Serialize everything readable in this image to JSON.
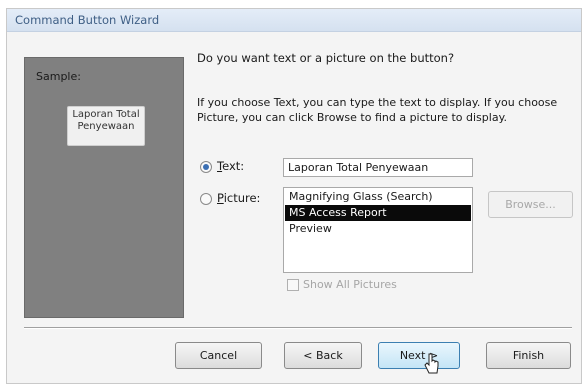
{
  "window": {
    "title": "Command Button Wizard"
  },
  "sample": {
    "label": "Sample:",
    "button_text": "Laporan Total Penyewaan"
  },
  "question": "Do you want text or a picture on the button?",
  "explanation": "If you choose Text, you can type the text to display.  If you choose Picture, you can click Browse to find a picture to display.",
  "options": {
    "text": {
      "label": "Text:",
      "accesskey": "T",
      "checked": true,
      "value": "Laporan Total Penyewaan"
    },
    "picture": {
      "label": "Picture:",
      "accesskey": "P",
      "checked": false
    }
  },
  "picture_list": {
    "items": [
      "Magnifying Glass (Search)",
      "MS Access Report",
      "Preview"
    ],
    "selected_index": 1
  },
  "browse_button": {
    "label": "Browse..."
  },
  "show_all_pictures": {
    "label": "Show All Pictures",
    "checked": false,
    "enabled": false
  },
  "buttons": {
    "cancel": "Cancel",
    "back": "< Back",
    "next": "Next >",
    "finish": "Finish"
  },
  "colors": {
    "sample_panel": "#808080",
    "selection": "#0a0a0a",
    "focus_border": "#3c7fb1",
    "title_text": "#3f5f85"
  }
}
